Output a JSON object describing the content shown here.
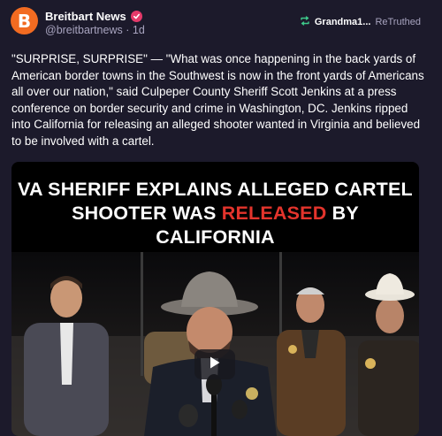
{
  "author": {
    "avatar_letter": "B",
    "display_name": "Breitbart News",
    "handle": "@breitbartnews",
    "separator": "·",
    "time": "1d"
  },
  "retruth": {
    "user": "Grandma1...",
    "label": "ReTruthed"
  },
  "post": {
    "text": "\"SURPRISE, SURPRISE\" — \"What was once happening in the back yards of American border towns in the Southwest is now in the front yards of Americans all over our nation,\" said Culpeper County Sheriff Scott Jenkins at a press conference on border security and crime in Washington, DC. Jenkins ripped into California for releasing an alleged shooter wanted in Virginia and believed to be involved with a cartel."
  },
  "video": {
    "headline_line1": "VA SHERIFF EXPLAINS ALLEGED CARTEL",
    "headline_line2_prefix": "SHOOTER WAS ",
    "headline_line2_highlight": "RELEASED",
    "headline_line2_suffix": " BY CALIFORNIA"
  },
  "colors": {
    "background": "#1c1a2b",
    "brand_orange": "#f26b21",
    "verified": "#e43a6a",
    "retruth_green": "#3ec98b",
    "muted_text": "#a8a4bf",
    "headline_highlight": "#e3342c"
  },
  "icons": {
    "verified": "verified-badge-icon",
    "retruth": "retruth-arrows-icon",
    "play": "play-icon"
  }
}
